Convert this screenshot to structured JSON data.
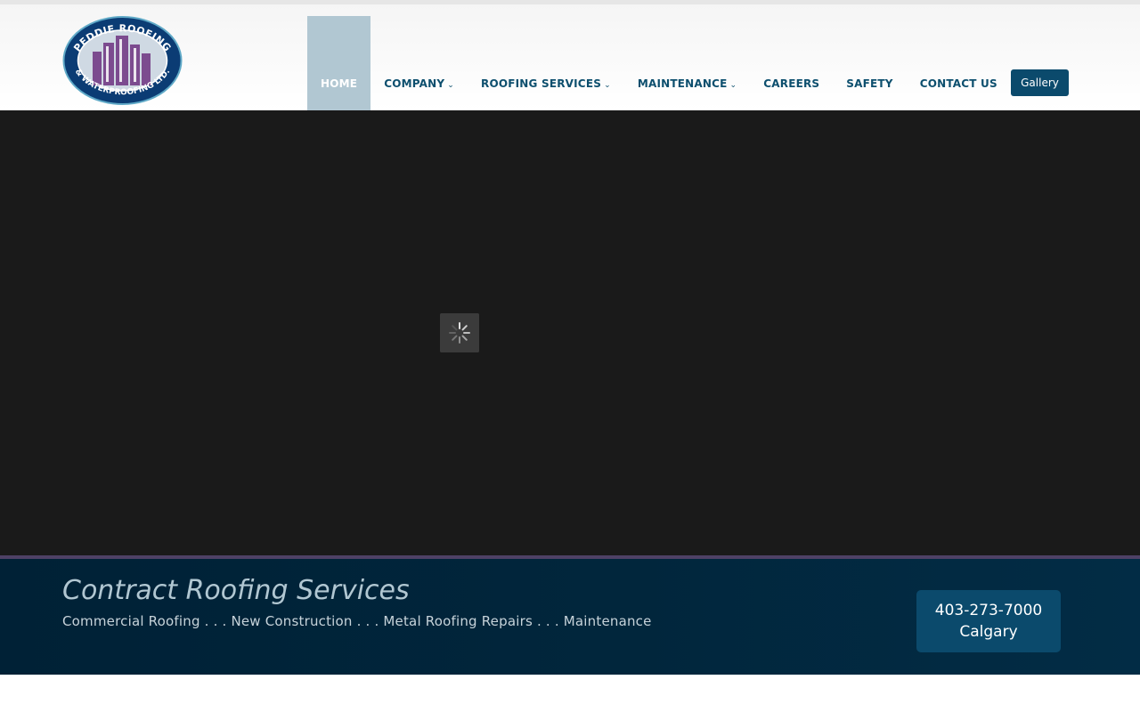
{
  "brand": {
    "logo_top_text": "PEDDIE ROOFING",
    "logo_bottom_text": "& WATERPROOFING LTD.",
    "colors": {
      "primary": "#0b4a6c",
      "nav_text": "#0d4f6e",
      "active_bg": "#b1c7d2",
      "banner_bg": "#01263c",
      "accent_line": "#4e4166"
    }
  },
  "nav": {
    "items": [
      {
        "label": "HOME",
        "active": true
      },
      {
        "label": "COMPANY",
        "dropdown": true
      },
      {
        "label": "ROOFING SERVICES",
        "dropdown": true
      },
      {
        "label": "MAINTENANCE",
        "dropdown": true
      },
      {
        "label": "CAREERS"
      },
      {
        "label": "SAFETY"
      },
      {
        "label": "CONTACT US"
      }
    ],
    "chevron_icon": "chevron-down-icon",
    "gallery_label": "Gallery"
  },
  "slider": {
    "loader_icon": "spinner-icon"
  },
  "banner": {
    "title": "Contract Roofing Services",
    "subtitle": "Commercial Roofing . . . New Construction . . . Metal Roofing Repairs . . . Maintenance",
    "phone": "403-273-7000",
    "city": "Calgary"
  }
}
